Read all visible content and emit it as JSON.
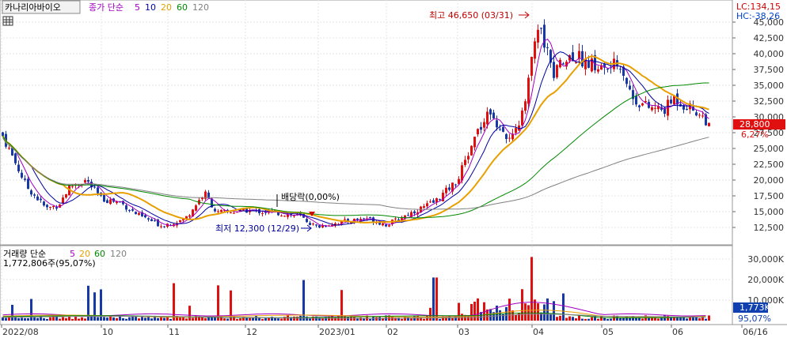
{
  "header": {
    "stock_name": "카나리아바이오",
    "price_label": "종가 단순",
    "ma_periods": [
      "5",
      "10",
      "20",
      "60",
      "120"
    ],
    "lc": "LC:134,15",
    "hc": "HC:-38,26"
  },
  "volume_header": {
    "label": "거래량 단순",
    "ma_periods": [
      "5",
      "20",
      "60",
      "120"
    ],
    "last_volume": "1,772,806주(95,07%)"
  },
  "annotations": {
    "high": "최고 46,650 (03/31)",
    "low": "최저 12,300 (12/29)",
    "dividend": "배당락(0,00%)",
    "last_price": "28,800",
    "last_change": "6,27%",
    "last_volume": "1,773K",
    "last_volume_pct": "95,07%"
  },
  "colors": {
    "up": "#e01010",
    "down": "#1838a8",
    "ma5": "#a000c0",
    "ma10": "#0000a0",
    "ma20": "#e8a000",
    "ma60": "#008800",
    "ma120": "#808080"
  },
  "chart_data": {
    "type": "line",
    "price_axis": {
      "ticks": [
        "45,000",
        "42,500",
        "40,000",
        "37,500",
        "35,000",
        "32,500",
        "30,000",
        "27,500",
        "25,000",
        "22,500",
        "20,000",
        "17,500",
        "15,000",
        "12,500"
      ],
      "ylim": [
        10000,
        47500
      ]
    },
    "volume_axis": {
      "ticks": [
        "30,000K",
        "20,000K",
        "10,000K"
      ],
      "ylim": [
        0,
        33000
      ]
    },
    "x_ticks": [
      "2022/08",
      "10",
      "11",
      "12",
      "2023/01",
      "02",
      "03",
      "04",
      "05",
      "06",
      "06/16"
    ],
    "price": [
      {
        "month": "2022/08",
        "value": 27000
      },
      {
        "month": "09",
        "value": 16500
      },
      {
        "month": "10",
        "value": 21000
      },
      {
        "month": "11",
        "value": 13000
      },
      {
        "month": "12",
        "value": 14800
      },
      {
        "month": "2023/01",
        "value": 14500
      },
      {
        "month": "02",
        "value": 13500
      },
      {
        "month": "03",
        "value": 27000
      },
      {
        "month": "04",
        "value": 38500
      },
      {
        "month": "05",
        "value": 35000
      },
      {
        "month": "06",
        "value": 30500
      },
      {
        "month": "06/16",
        "value": 28800
      }
    ],
    "high": {
      "date": "03/31",
      "value": 46650
    },
    "low": {
      "date": "12/29",
      "value": 12300
    }
  }
}
